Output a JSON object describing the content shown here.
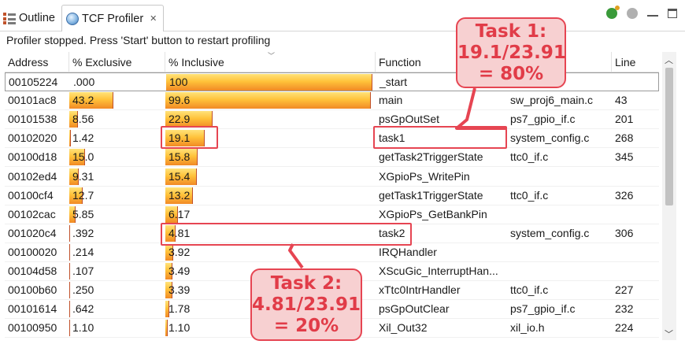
{
  "tabs": [
    {
      "label": "Outline",
      "icon": "outline-icon",
      "active": false
    },
    {
      "label": "TCF Profiler",
      "icon": "profiler-icon",
      "active": true
    }
  ],
  "toolbar": {
    "icons": [
      "start-profiling-icon",
      "stop-profiling-icon",
      "minimize-icon",
      "maximize-icon"
    ]
  },
  "status_text": "Profiler stopped. Press 'Start' button to restart profiling",
  "columns": [
    "Address",
    "% Exclusive",
    "% Inclusive",
    "Function",
    "",
    "Line"
  ],
  "rows": [
    {
      "address": "00105224",
      "exclusive": ".000",
      "inclusive": "100",
      "function": "_start",
      "file": "",
      "line": "",
      "exclusive_pct": 0.0,
      "inclusive_pct": 100
    },
    {
      "address": "00101ac8",
      "exclusive": "43.2",
      "inclusive": "99.6",
      "function": "main",
      "file": "sw_proj6_main.c",
      "line": "43",
      "exclusive_pct": 43.2,
      "inclusive_pct": 99.6
    },
    {
      "address": "00101538",
      "exclusive": "8.56",
      "inclusive": "22.9",
      "function": "psGpOutSet",
      "file": "ps7_gpio_if.c",
      "line": "201",
      "exclusive_pct": 8.56,
      "inclusive_pct": 22.9
    },
    {
      "address": "00102020",
      "exclusive": "1.42",
      "inclusive": "19.1",
      "function": "task1",
      "file": "system_config.c",
      "line": "268",
      "exclusive_pct": 1.42,
      "inclusive_pct": 19.1
    },
    {
      "address": "00100d18",
      "exclusive": "15.0",
      "inclusive": "15.8",
      "function": "getTask2TriggerState",
      "file": "ttc0_if.c",
      "line": "345",
      "exclusive_pct": 15.0,
      "inclusive_pct": 15.8
    },
    {
      "address": "00102ed4",
      "exclusive": "9.31",
      "inclusive": "15.4",
      "function": "XGpioPs_WritePin",
      "file": "",
      "line": "",
      "exclusive_pct": 9.31,
      "inclusive_pct": 15.4
    },
    {
      "address": "00100cf4",
      "exclusive": "12.7",
      "inclusive": "13.2",
      "function": "getTask1TriggerState",
      "file": "ttc0_if.c",
      "line": "326",
      "exclusive_pct": 12.7,
      "inclusive_pct": 13.2
    },
    {
      "address": "00102cac",
      "exclusive": "5.85",
      "inclusive": "6.17",
      "function": "XGpioPs_GetBankPin",
      "file": "",
      "line": "",
      "exclusive_pct": 5.85,
      "inclusive_pct": 6.17
    },
    {
      "address": "001020c4",
      "exclusive": ".392",
      "inclusive": "4.81",
      "function": "task2",
      "file": "system_config.c",
      "line": "306",
      "exclusive_pct": 0.392,
      "inclusive_pct": 4.81
    },
    {
      "address": "00100020",
      "exclusive": ".214",
      "inclusive": "3.92",
      "function": "IRQHandler",
      "file": "",
      "line": "",
      "exclusive_pct": 0.214,
      "inclusive_pct": 3.92
    },
    {
      "address": "00104d58",
      "exclusive": ".107",
      "inclusive": "3.49",
      "function": "XScuGic_InterruptHan...",
      "file": "",
      "line": "",
      "exclusive_pct": 0.107,
      "inclusive_pct": 3.49
    },
    {
      "address": "00100b60",
      "exclusive": ".250",
      "inclusive": "3.39",
      "function": "xTtc0IntrHandler",
      "file": "ttc0_if.c",
      "line": "227",
      "exclusive_pct": 0.25,
      "inclusive_pct": 3.39
    },
    {
      "address": "00101614",
      "exclusive": ".642",
      "inclusive": "1.78",
      "function": "psGpOutClear",
      "file": "ps7_gpio_if.c",
      "line": "232",
      "exclusive_pct": 0.642,
      "inclusive_pct": 1.78
    },
    {
      "address": "00100950",
      "exclusive": "1.10",
      "inclusive": "1.10",
      "function": "Xil_Out32",
      "file": "xil_io.h",
      "line": "224",
      "exclusive_pct": 1.1,
      "inclusive_pct": 1.1
    }
  ],
  "annotations": {
    "task1": {
      "line1": "Task 1:",
      "line2": "19.1/23.91",
      "line3": "= 80%"
    },
    "task2": {
      "line1": "Task 2:",
      "line2": "4.81/23.91",
      "line3": "= 20%"
    }
  },
  "colors": {
    "accent_red": "#e64552",
    "callout_fill": "#f7d0d1",
    "bar_top": "#ffe27a",
    "bar_bottom": "#f18a26"
  }
}
